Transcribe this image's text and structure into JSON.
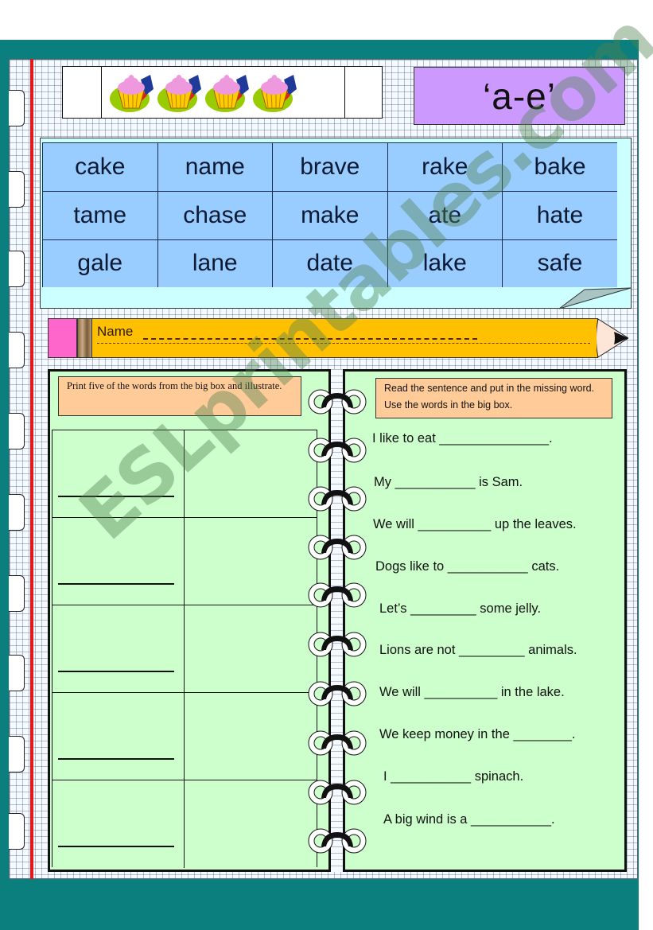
{
  "header": {
    "title": "‘a-e’",
    "cupcake_count": 4
  },
  "word_box": {
    "rows": [
      [
        "cake",
        "name",
        "brave",
        "rake",
        "bake"
      ],
      [
        "tame",
        "chase",
        "make",
        "ate",
        "hate"
      ],
      [
        "gale",
        "lane",
        "date",
        "lake",
        "safe"
      ]
    ]
  },
  "name_field": {
    "label": "Name",
    "value": ""
  },
  "left_panel": {
    "instruction": "Print five of the words from the big box and illustrate.",
    "rows": 5
  },
  "right_panel": {
    "instruction": "Read the sentence and put in the missing word. Use the words in the big box.",
    "sentences": [
      "I like to eat _______________.",
      "My ___________ is Sam.",
      "We will __________ up the leaves.",
      "Dogs like to ___________ cats.",
      "Let’s _________ some jelly.",
      "Lions are not _________ animals.",
      "We will __________ in the lake.",
      "We keep money in the ________.",
      "I ___________ spinach.",
      "A big wind is a ___________."
    ]
  },
  "watermark": "ESLprintables.com",
  "colors": {
    "background_frame": "#0b7f7d",
    "title_box": "#cc99ff",
    "word_cells": "#99ccff",
    "word_box_bg": "#ccffff",
    "pencil_body": "#ffc000",
    "pencil_eraser": "#ff66cc",
    "panel_bg": "#ccffcc",
    "instruction_bg": "#ffcc99",
    "margin_line": "#e3171b"
  }
}
